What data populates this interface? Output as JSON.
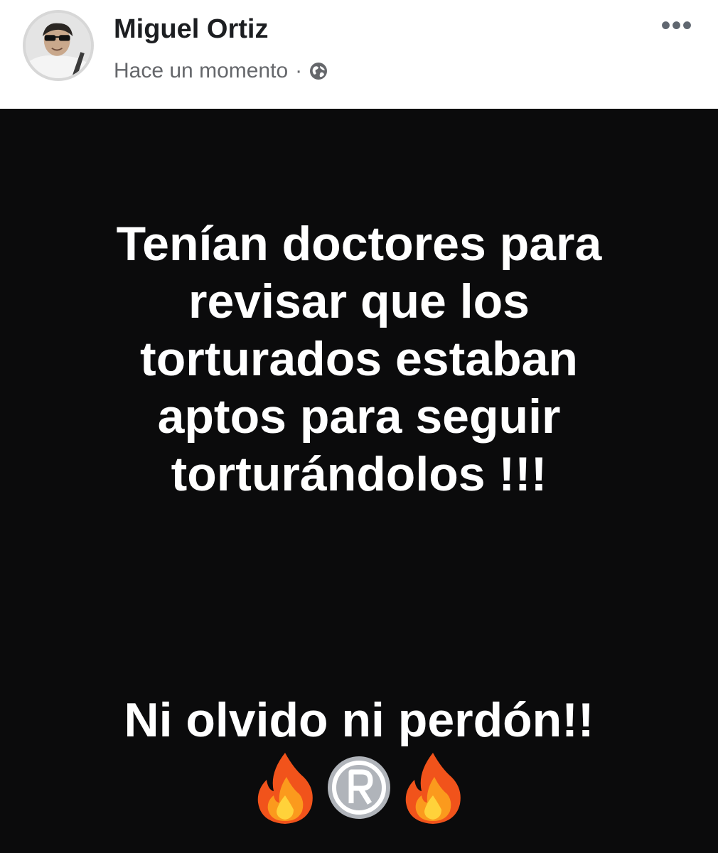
{
  "post": {
    "author": "Miguel Ortiz",
    "timestamp": "Hace un momento",
    "separator": "·",
    "privacy_icon": "globe-icon",
    "more_icon": "more-options-icon",
    "more_label": "•••",
    "text": "Tenían doctores para\nrevisar que los\ntorturados estaban\naptos para seguir\ntorturándolos !!!",
    "closing": "Ni olvido ni perdón!!",
    "emojis": [
      "fire-icon",
      "registered-icon",
      "fire-icon"
    ],
    "colors": {
      "card_background": "#0b0b0c",
      "text": "#ffffff",
      "name": "#1c1e21",
      "meta": "#65676b"
    }
  }
}
